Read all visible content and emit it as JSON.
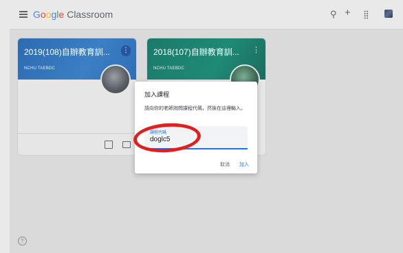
{
  "app": {
    "logo_google": [
      "G",
      "o",
      "o",
      "g",
      "l",
      "e"
    ],
    "logo_classroom": "Classroom"
  },
  "topbar": {
    "icons": [
      "menu-icon",
      "thumbtack-icon",
      "plus-icon",
      "apps-grid-icon",
      "account-avatar"
    ]
  },
  "courses": [
    {
      "title": "2019(108)自辦教育訓...",
      "subtitle": "NCHU TAEBDC",
      "more": "⋮"
    },
    {
      "title": "2018(107)自辦教育訓...",
      "subtitle": "NCHU TAEBDC",
      "more": "⋮"
    }
  ],
  "dialog": {
    "title": "加入課程",
    "description": "請向你的老師詢問課程代碼，然後在這裡輸入。",
    "field_label": "課程代碼",
    "field_value": "doglc5",
    "cancel_label": "取消",
    "join_label": "加入"
  },
  "help": {
    "label": "?"
  },
  "colors": {
    "annotation_circle": "#e0201f",
    "accent": "#1a73e8",
    "card1_banner": "#2c6bb1",
    "card2_banner": "#1b7a6a"
  }
}
